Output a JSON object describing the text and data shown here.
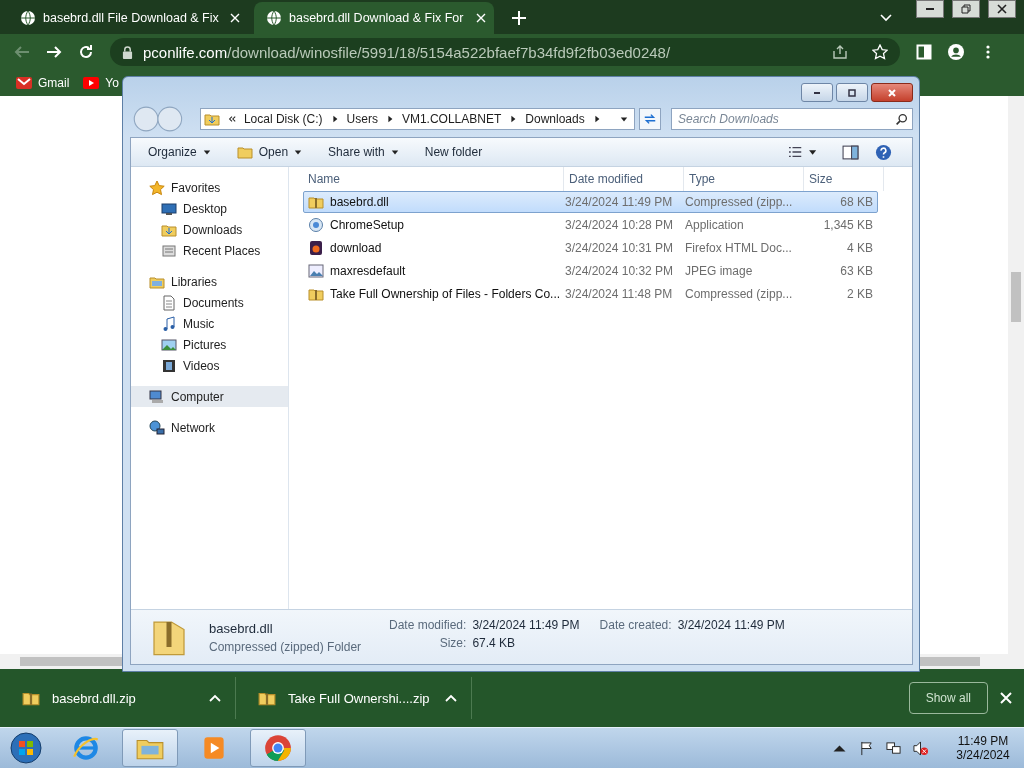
{
  "browser": {
    "tabs": [
      {
        "title": "basebrd.dll File Download & Fix",
        "selected": false
      },
      {
        "title": "basebrd.dll Download & Fix For",
        "selected": true
      }
    ],
    "url_host": "pconlife.com",
    "url_path": "/download/winosfile/5991/18/5154a522bfaef7b34fd9f2fb03ed0248/",
    "bookmarks": [
      {
        "label": "Gmail",
        "kind": "mail"
      },
      {
        "label": "Yo",
        "kind": "video"
      }
    ]
  },
  "explorer": {
    "breadcrumb": [
      "Local Disk (C:)",
      "Users",
      "VM1.COLLABNET",
      "Downloads"
    ],
    "search": {
      "placeholder": "Search Downloads"
    },
    "toolbar": [
      {
        "label": "Organize",
        "kind": "menu"
      },
      {
        "label": "Open",
        "kind": "open"
      },
      {
        "label": "Share with",
        "kind": "menu"
      },
      {
        "label": "New folder",
        "kind": "plain"
      }
    ],
    "nav": [
      {
        "label": "Favorites",
        "kind": "star",
        "selected": false,
        "children": [
          {
            "label": "Desktop",
            "kind": "desktop",
            "selected": false
          },
          {
            "label": "Downloads",
            "kind": "downloads",
            "selected": false
          },
          {
            "label": "Recent Places",
            "kind": "recent",
            "selected": false
          }
        ]
      },
      {
        "label": "Libraries",
        "kind": "library",
        "selected": false,
        "children": [
          {
            "label": "Documents",
            "kind": "docs",
            "selected": false
          },
          {
            "label": "Music",
            "kind": "music",
            "selected": false
          },
          {
            "label": "Pictures",
            "kind": "pictures",
            "selected": false
          },
          {
            "label": "Videos",
            "kind": "videos",
            "selected": false
          }
        ]
      },
      {
        "label": "Computer",
        "kind": "computer",
        "selected": true
      },
      {
        "label": "Network",
        "kind": "network",
        "selected": false
      }
    ],
    "columns": [
      "Name",
      "Date modified",
      "Type",
      "Size"
    ],
    "rows": [
      {
        "name": "basebrd.dll",
        "kind": "zip",
        "date": "3/24/2024 11:49 PM",
        "type": "Compressed (zipp...",
        "size": "68 KB",
        "selected": true
      },
      {
        "name": "ChromeSetup",
        "kind": "app",
        "date": "3/24/2024 10:28 PM",
        "type": "Application",
        "size": "1,345 KB",
        "selected": false
      },
      {
        "name": "download",
        "kind": "html",
        "date": "3/24/2024 10:31 PM",
        "type": "Firefox HTML Doc...",
        "size": "4 KB",
        "selected": false
      },
      {
        "name": "maxresdefault",
        "kind": "image",
        "date": "3/24/2024 10:32 PM",
        "type": "JPEG image",
        "size": "63 KB",
        "selected": false
      },
      {
        "name": "Take Full Ownership of Files - Folders Co...",
        "kind": "zip",
        "date": "3/24/2024 11:48 PM",
        "type": "Compressed (zipp...",
        "size": "2 KB",
        "selected": false
      }
    ],
    "details": {
      "name": "basebrd.dll",
      "type": "Compressed (zipped) Folder",
      "modified_label": "Date modified:",
      "modified": "3/24/2024 11:49 PM",
      "created_label": "Date created:",
      "created": "3/24/2024 11:49 PM",
      "size_label": "Size:",
      "size": "67.4 KB"
    }
  },
  "downloads": {
    "items": [
      {
        "name": "basebrd.dll.zip"
      },
      {
        "name": "Take Full Ownershi....zip"
      }
    ],
    "show_all": "Show all"
  },
  "taskbar": {
    "apps": [
      {
        "kind": "ie",
        "active": false
      },
      {
        "kind": "explorer",
        "active": true
      },
      {
        "kind": "media",
        "active": false
      },
      {
        "kind": "chrome",
        "active": true
      }
    ],
    "time": "11:49 PM",
    "date": "3/24/2024"
  }
}
